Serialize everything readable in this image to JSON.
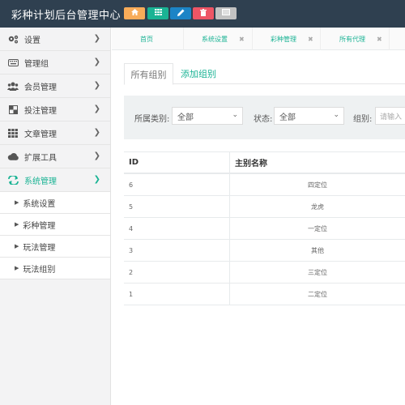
{
  "app": {
    "title": "彩种计划后台管理中心"
  },
  "toolbar": {
    "buttons": [
      {
        "icon": "home-icon",
        "color": "#f8ac59"
      },
      {
        "icon": "grid-icon",
        "color": "#1ab394"
      },
      {
        "icon": "pencil-icon",
        "color": "#1c84c6"
      },
      {
        "icon": "trash-icon",
        "color": "#ed5565"
      },
      {
        "icon": "list-icon",
        "color": "#c2c2c2"
      }
    ]
  },
  "sidebar": {
    "items": [
      {
        "label": "设置",
        "icon": "gears-icon"
      },
      {
        "label": "管理组",
        "icon": "keyboard-icon"
      },
      {
        "label": "会员管理",
        "icon": "users-icon"
      },
      {
        "label": "投注管理",
        "icon": "square-icon"
      },
      {
        "label": "文章管理",
        "icon": "th-icon"
      },
      {
        "label": "扩展工具",
        "icon": "cloud-icon"
      },
      {
        "label": "系统管理",
        "icon": "refresh-icon",
        "active": true
      }
    ],
    "subitems": [
      {
        "label": "系统设置"
      },
      {
        "label": "彩种管理"
      },
      {
        "label": "玩法管理"
      },
      {
        "label": "玩法组别"
      }
    ]
  },
  "tabs": [
    {
      "label": "首页"
    },
    {
      "label": "系统设置"
    },
    {
      "label": "彩种管理"
    },
    {
      "label": "所有代理"
    }
  ],
  "content": {
    "tabs": [
      {
        "label": "所有组别"
      },
      {
        "label": "添加组别"
      }
    ],
    "filter": {
      "category_label": "所属类别:",
      "category_value": "全部",
      "status_label": "状态:",
      "status_value": "全部",
      "group_label": "组别:",
      "group_placeholder": "请输入"
    },
    "table": {
      "columns": [
        "ID",
        "主别名称"
      ],
      "rows": [
        {
          "id": "6",
          "name": "四定位"
        },
        {
          "id": "5",
          "name": "龙虎"
        },
        {
          "id": "4",
          "name": "一定位"
        },
        {
          "id": "3",
          "name": "其他"
        },
        {
          "id": "2",
          "name": "三定位"
        },
        {
          "id": "1",
          "name": "二定位"
        }
      ]
    }
  },
  "accent_color": "#1ab394"
}
